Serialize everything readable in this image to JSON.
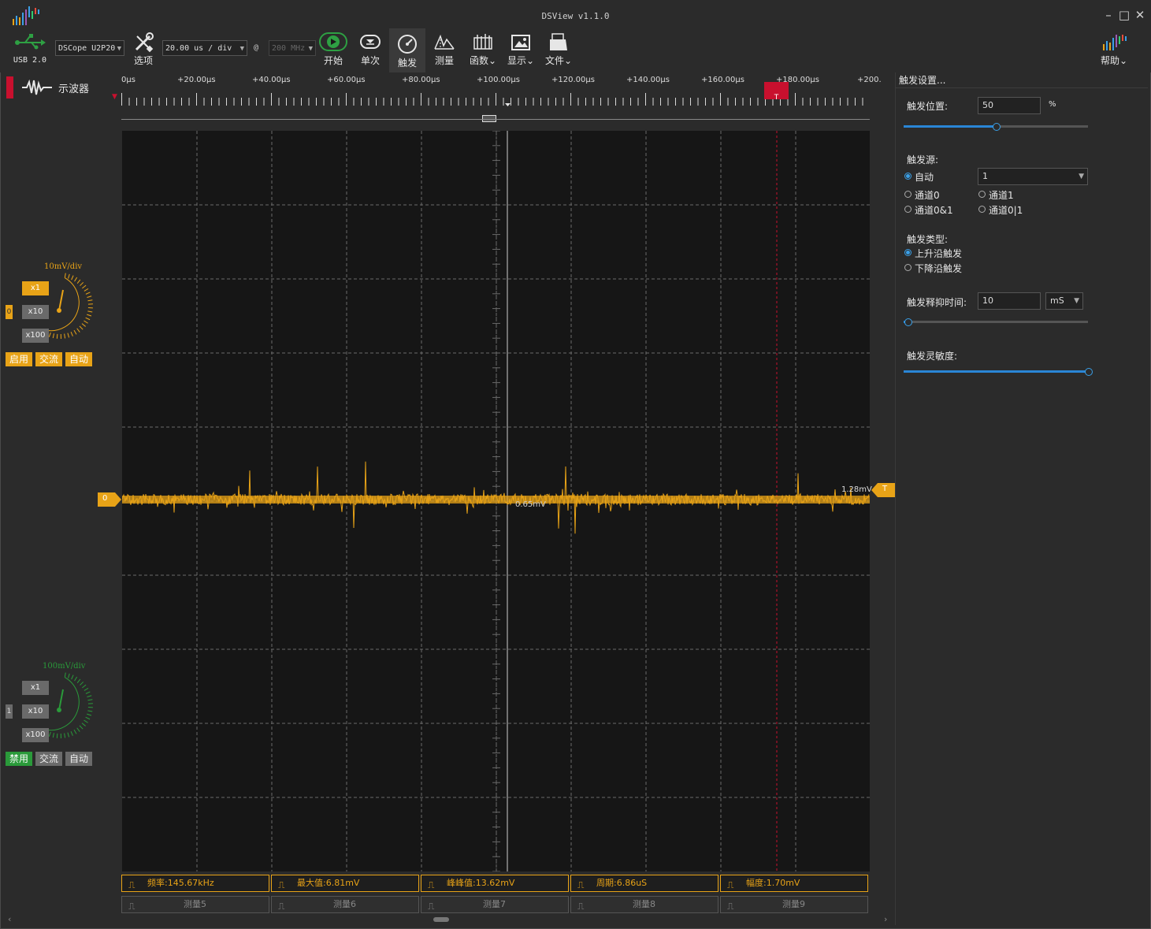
{
  "window": {
    "title": "DSView v1.1.0"
  },
  "toolbar": {
    "usb_label": "USB 2.0",
    "device": "DSCope U2P20",
    "options_label": "选项",
    "timebase": "20.00 us / div",
    "at_symbol": "@",
    "samplerate": "200 MHz",
    "start_label": "开始",
    "single_label": "单次",
    "trigger_label": "触发",
    "measure_label": "测量",
    "function_label": "函数",
    "display_label": "显示",
    "file_label": "文件",
    "help_label": "帮助"
  },
  "mode": {
    "label": "示波器"
  },
  "ruler": {
    "labels": [
      "0µs",
      "+20.00µs",
      "+40.00µs",
      "+60.00µs",
      "+80.00µs",
      "+100.00µs",
      "+120.00µs",
      "+140.00µs",
      "+160.00µs",
      "+180.00µs",
      "+200."
    ],
    "trigger_marker": "T"
  },
  "channels": [
    {
      "index": "0",
      "vdiv": "10mV/div",
      "color": "#e8a317",
      "x1": "x1",
      "x10": "x10",
      "x100": "x100",
      "enable": "启用",
      "coupling": "交流",
      "auto": "自动"
    },
    {
      "index": "1",
      "vdiv": "100mV/div",
      "color": "#2a9a3a",
      "x1": "x1",
      "x10": "x10",
      "x100": "x100",
      "enable": "禁用",
      "coupling": "交流",
      "auto": "自动"
    }
  ],
  "scope": {
    "ch0_marker": "0",
    "trigger_level_marker": "T",
    "trigger_level_text": "1.28mV",
    "center_readout": "0.65mV"
  },
  "measurements": {
    "active": [
      "频率:145.67kHz",
      "最大值:6.81mV",
      "峰峰值:13.62mV",
      "周期:6.86uS",
      "幅度:1.70mV"
    ],
    "inactive": [
      "测量5",
      "测量6",
      "测量7",
      "测量8",
      "测量9"
    ]
  },
  "trigger_panel": {
    "title": "触发设置...",
    "position_label": "触发位置:",
    "position_value": "50",
    "position_unit": "%",
    "position_fraction": 0.5,
    "source_label": "触发源:",
    "source_auto": "自动",
    "source_channel_value": "1",
    "source_ch0": "通道0",
    "source_ch1": "通道1",
    "source_ch0and1": "通道0&1",
    "source_ch0or1": "通道0|1",
    "type_label": "触发类型:",
    "type_rising": "上升沿触发",
    "type_falling": "下降沿触发",
    "holdoff_label": "触发释抑时间:",
    "holdoff_value": "10",
    "holdoff_unit": "mS",
    "holdoff_fraction": 0.02,
    "sensitivity_label": "触发灵敏度:",
    "sensitivity_fraction": 1.0
  }
}
